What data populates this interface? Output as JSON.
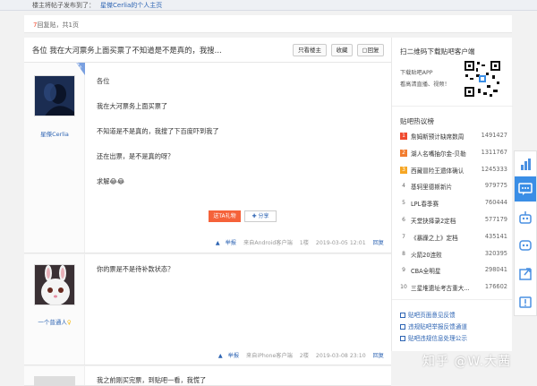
{
  "topbar": {
    "notice": "楼主将帖子发布到了：",
    "link": "星傑Cerlia的个人主页"
  },
  "replybar": {
    "count": "7",
    "count_suffix": "回复贴，共",
    "pages": "1",
    "pages_suffix": "页"
  },
  "thread": {
    "title": "各位 我在大河票务上面买票了不知道是不是真的，我搜...",
    "btn_only_op": "只看楼主",
    "btn_collect": "收藏",
    "btn_reply": "回复"
  },
  "posts": [
    {
      "badge": "楼主",
      "user": "星傑Cerlia",
      "lines": [
        "各位",
        "我在大河票务上面买票了",
        "不知道是不是真的，我搜了下百度吓到我了",
        "还在出票，是不是真的呀？",
        "求解😂😂"
      ],
      "gift": "送TA礼物",
      "share": "分享",
      "report": "举报",
      "source": "来自Android客户端",
      "floor": "1楼",
      "time": "2019-03-05 12:01",
      "reply": "回复"
    },
    {
      "user": "一个普通人",
      "lines": [
        "你的票是不是待补款状态？"
      ],
      "report": "举报",
      "source": "来自iPhone客户端",
      "floor": "2楼",
      "time": "2019-03-08 23:10",
      "reply": "回复"
    },
    {
      "lines": [
        "我之前刚买完票，到贴吧一看，我慌了"
      ]
    }
  ],
  "right": {
    "qr_title": "扫二维码下载贴吧客户端",
    "qr_sub1": "下载贴吧APP",
    "qr_sub2": "看高清直播、视频！",
    "hot_title": "贴吧热议榜",
    "hot": [
      {
        "idx": "1",
        "text": "詹姆斯预计缺席数周",
        "num": "1491427",
        "color": "#f04a2f"
      },
      {
        "idx": "2",
        "text": "湖人名嘴抽尔金-贝勒",
        "num": "1311767",
        "color": "#f27c2e"
      },
      {
        "idx": "3",
        "text": "西藏冒险王遗体确认",
        "num": "1245333",
        "color": "#f6a623"
      },
      {
        "idx": "4",
        "text": "基轲里德斯新片",
        "num": "979775",
        "color": ""
      },
      {
        "idx": "5",
        "text": "LPL春季赛",
        "num": "760444",
        "color": ""
      },
      {
        "idx": "6",
        "text": "天堂抉择录2定档",
        "num": "577179",
        "color": ""
      },
      {
        "idx": "7",
        "text": "《暴躁之上》定档",
        "num": "435141",
        "color": ""
      },
      {
        "idx": "8",
        "text": "火箭20连败",
        "num": "320395",
        "color": ""
      },
      {
        "idx": "9",
        "text": "CBA全明星",
        "num": "298041",
        "color": ""
      },
      {
        "idx": "10",
        "text": "三星堆遗址考古重大...",
        "num": "176602",
        "color": ""
      }
    ],
    "links": [
      "贴吧页面意见反馈",
      "违规贴吧举报反馈通道",
      "贴吧违规信息处理公示"
    ]
  },
  "watermark": "知乎 @W.大茜"
}
